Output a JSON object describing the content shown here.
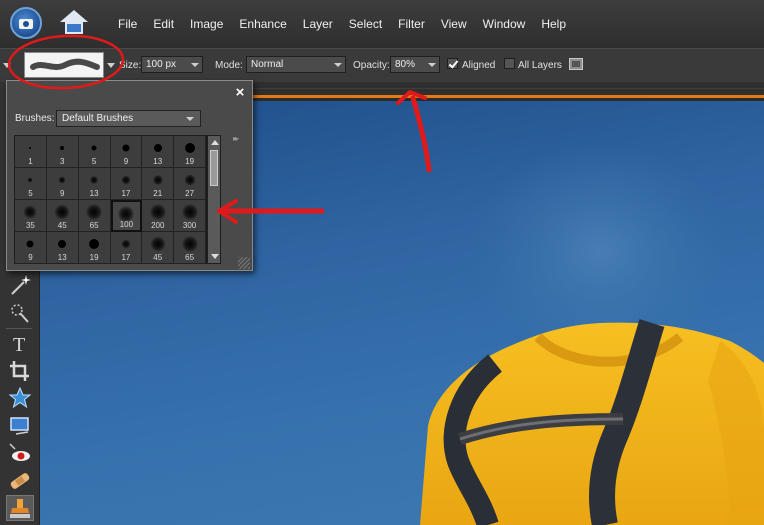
{
  "menu": [
    "File",
    "Edit",
    "Image",
    "Enhance",
    "Layer",
    "Select",
    "Filter",
    "View",
    "Window",
    "Help"
  ],
  "options_bar": {
    "size_label": "Size:",
    "size_value": "100 px",
    "mode_label": "Mode:",
    "mode_value": "Normal",
    "opacity_label": "Opacity:",
    "opacity_value": "80%",
    "aligned_label": "Aligned",
    "aligned_checked": true,
    "all_layers_label": "All Layers",
    "all_layers_checked": false
  },
  "brush_panel": {
    "close_glyph": "×",
    "brushes_label": "Brushes:",
    "brushes_value": "Default Brushes",
    "menu_glyph": "▸▸",
    "selected_index": 15,
    "brushes": [
      {
        "size": "1",
        "kind": "hard"
      },
      {
        "size": "3",
        "kind": "hard"
      },
      {
        "size": "5",
        "kind": "hard"
      },
      {
        "size": "9",
        "kind": "hard"
      },
      {
        "size": "13",
        "kind": "hard"
      },
      {
        "size": "19",
        "kind": "hard"
      },
      {
        "size": "5",
        "kind": "soft"
      },
      {
        "size": "9",
        "kind": "soft"
      },
      {
        "size": "13",
        "kind": "soft"
      },
      {
        "size": "17",
        "kind": "soft"
      },
      {
        "size": "21",
        "kind": "soft"
      },
      {
        "size": "27",
        "kind": "soft"
      },
      {
        "size": "35",
        "kind": "soft"
      },
      {
        "size": "45",
        "kind": "soft"
      },
      {
        "size": "65",
        "kind": "soft"
      },
      {
        "size": "100",
        "kind": "soft"
      },
      {
        "size": "200",
        "kind": "soft"
      },
      {
        "size": "300",
        "kind": "soft"
      },
      {
        "size": "9",
        "kind": "hard"
      },
      {
        "size": "13",
        "kind": "hard"
      },
      {
        "size": "19",
        "kind": "hard"
      },
      {
        "size": "17",
        "kind": "soft"
      },
      {
        "size": "45",
        "kind": "soft"
      },
      {
        "size": "65",
        "kind": "soft"
      }
    ]
  },
  "toolbox": {
    "tools": [
      "magic-wand",
      "quick-selection",
      "type",
      "crop",
      "cookie-cutter",
      "straighten",
      "red-eye",
      "healing-brush",
      "clone-stamp"
    ],
    "active_tool": "clone-stamp"
  },
  "colors": {
    "accent": "#e37a16",
    "annotation": "#e01a1a",
    "sky": "#3671ad",
    "shirt": "#f2b51c"
  }
}
